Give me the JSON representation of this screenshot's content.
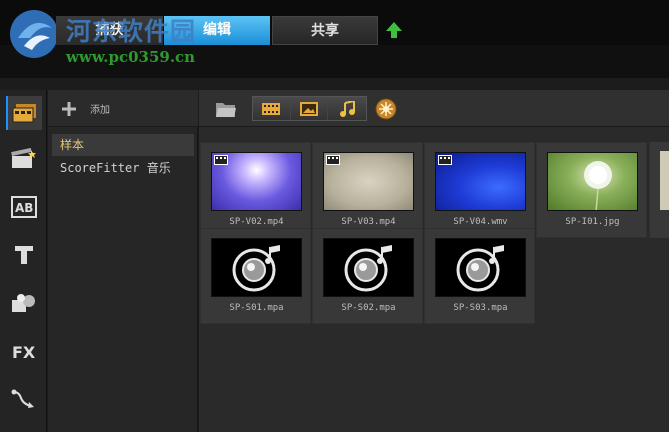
{
  "watermark": {
    "title": "河东软件园",
    "url": "www.pc0359.cn"
  },
  "tabs": [
    {
      "label": "捕获"
    },
    {
      "label": "编辑"
    },
    {
      "label": "共享"
    }
  ],
  "colors": {
    "accent": "#1a8fd8",
    "selected_text": "#e6c67a"
  },
  "library": {
    "add_label": "添加",
    "items": [
      {
        "label": "样本"
      },
      {
        "label": "ScoreFitter 音乐"
      }
    ]
  },
  "filters": [
    {
      "icon": "video-filter-icon"
    },
    {
      "icon": "photo-filter-icon"
    },
    {
      "icon": "music-filter-icon"
    }
  ],
  "clips": [
    {
      "name": "SP-V02.mp4",
      "kind": "video"
    },
    {
      "name": "SP-V03.mp4",
      "kind": "video"
    },
    {
      "name": "SP-V04.wmv",
      "kind": "video"
    },
    {
      "name": "SP-I01.jpg",
      "kind": "image"
    },
    {
      "name": "SP-S01.mpa",
      "kind": "audio"
    },
    {
      "name": "SP-S02.mpa",
      "kind": "audio"
    },
    {
      "name": "SP-S03.mpa",
      "kind": "audio"
    }
  ]
}
